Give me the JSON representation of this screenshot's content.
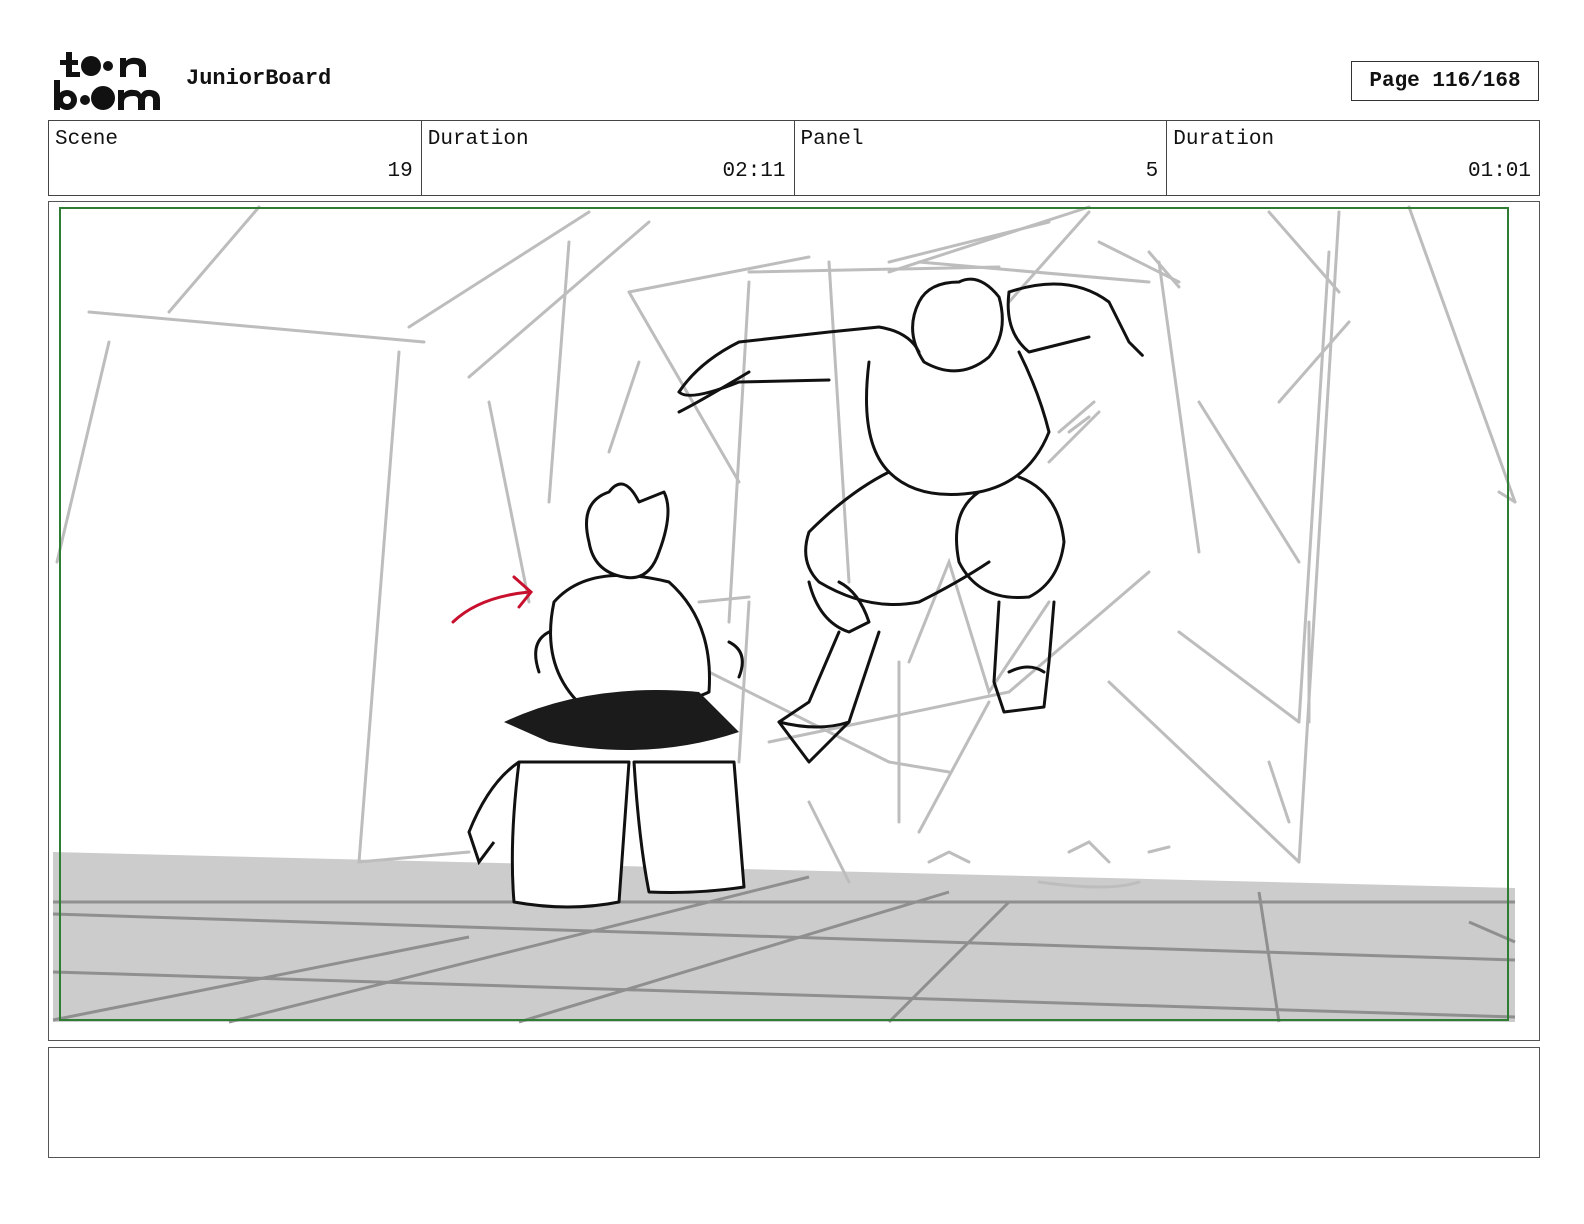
{
  "header": {
    "logo_text": [
      "toon",
      "boom"
    ],
    "app_name": "JuniorBoard",
    "page_label": "Page 116/168"
  },
  "info": {
    "scene_label": "Scene",
    "scene_value": "19",
    "scene_duration_label": "Duration",
    "scene_duration_value": "02:11",
    "panel_label": "Panel",
    "panel_value": "5",
    "panel_duration_label": "Duration",
    "panel_duration_value": "01:01"
  },
  "colors": {
    "safe_frame": "#2e7d32",
    "motion_arrow": "#c8102e",
    "floor": "#cccccc",
    "background_lines": "#bdbdbd"
  },
  "notes": {
    "text": ""
  }
}
